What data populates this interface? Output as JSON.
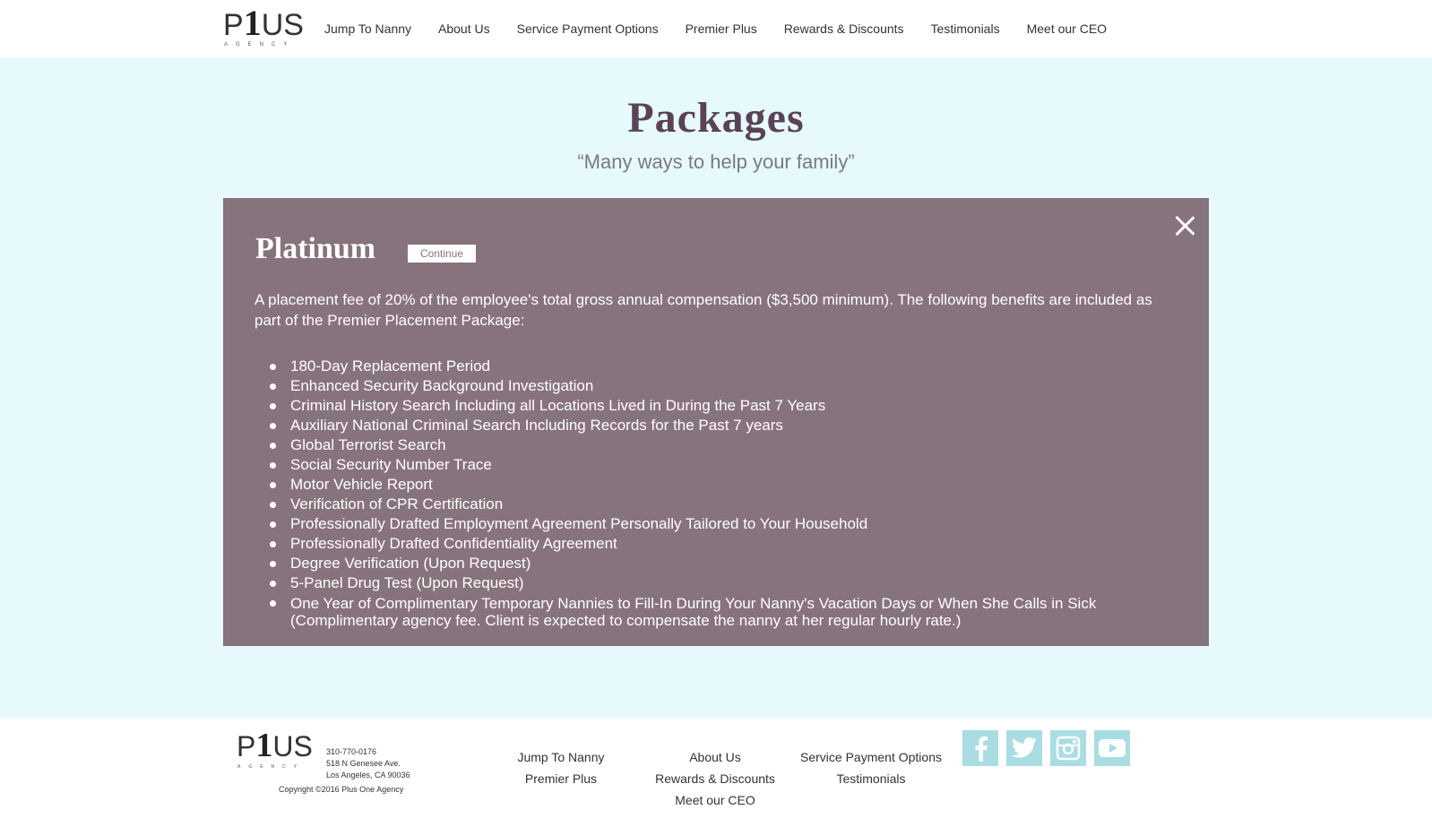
{
  "header": {
    "logo": {
      "word_p": "P",
      "word_one": "1",
      "word_us": "US",
      "sub": "AGENCY"
    },
    "nav": [
      "Jump To Nanny",
      "About Us",
      "Service Payment Options",
      "Premier Plus",
      "Rewards & Discounts",
      "Testimonials",
      "Meet our CEO"
    ]
  },
  "main": {
    "title": "Packages",
    "subtitle": "“Many ways to help your family”",
    "panel": {
      "title": "Platinum",
      "continue_label": "Continue",
      "description": "A placement fee of 20% of the employee's total gross annual compensation ($3,500 minimum). The following benefits are included as part of the Premier Placement Package:",
      "benefits": [
        "180-Day Replacement Period",
        "Enhanced Security Background Investigation",
        "Criminal History Search Including all Locations Lived in During the Past 7 Years",
        "Auxiliary National Criminal Search Including Records for the Past 7 years",
        "Global Terrorist Search",
        "Social Security Number Trace",
        "Motor Vehicle Report",
        "Verification of CPR Certification",
        "Professionally Drafted Employment Agreement Personally Tailored to Your Household",
        "Professionally Drafted Confidentiality Agreement",
        "Degree Verification (Upon Request)",
        "5-Panel Drug Test (Upon Request)",
        "One Year of Complimentary Temporary Nannies to Fill-In During Your Nanny's Vacation Days or When She Calls in Sick (Complimentary agency fee. Client is expected to compensate the nanny at her regular hourly rate.)"
      ],
      "colors": {
        "panel_bg": "#87737d",
        "title_color": "#5a4257"
      }
    }
  },
  "footer": {
    "logo": {
      "word_p": "P",
      "word_one": "1",
      "word_us": "US",
      "sub": "AGENCY"
    },
    "contact": {
      "phone": "310-770-0176",
      "address1": "518 N Genesee Ave.",
      "address2": "Los Angeles, CA 90036"
    },
    "copyright": "Copyright ©2016 Plus One Agency",
    "nav_col1": [
      "Jump To Nanny",
      "Premier Plus"
    ],
    "nav_col2": [
      "About Us",
      "Rewards & Discounts",
      "Meet our CEO"
    ],
    "nav_col3": [
      "Service Payment Options",
      "Testimonials"
    ],
    "social": [
      "facebook-icon",
      "twitter-icon",
      "instagram-icon",
      "youtube-icon"
    ]
  }
}
